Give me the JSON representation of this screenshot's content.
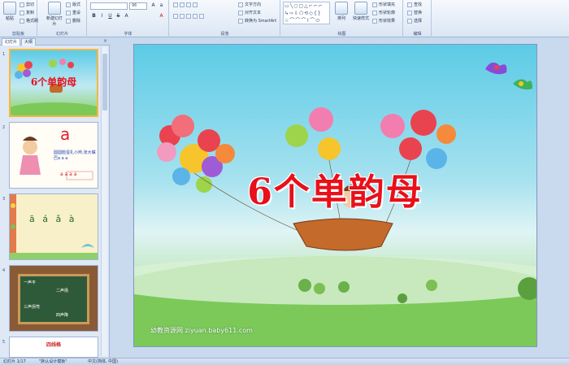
{
  "ribbon": {
    "clipboard": {
      "paste_label": "粘贴",
      "cut_label": "剪切",
      "copy_label": "复制",
      "format_painter_label": "格式刷",
      "group_label": "剪贴板"
    },
    "slides": {
      "new_slide_label": "新建幻灯片",
      "layout_label": "版式",
      "reset_label": "重设",
      "delete_label": "删除",
      "group_label": "幻灯片"
    },
    "font": {
      "font_size": "96",
      "group_label": "字体",
      "bold": "B",
      "italic": "I",
      "underline": "U",
      "strike": "S",
      "shadow": "A",
      "font_color": "A"
    },
    "paragraph": {
      "text_direction_label": "文字方向",
      "align_text_label": "对齐文本",
      "smartart_label": "转换为 SmartArt",
      "group_label": "段落"
    },
    "drawing": {
      "arrange_label": "排列",
      "quick_styles_label": "快速样式",
      "shape_fill_label": "形状填充",
      "shape_outline_label": "形状轮廓",
      "shape_effects_label": "形状效果",
      "group_label": "绘图"
    },
    "editing": {
      "find_label": "查找",
      "replace_label": "替换",
      "select_label": "选择",
      "group_label": "编辑"
    }
  },
  "left_pane": {
    "tab_slides": "幻灯片",
    "tab_outline": "大纲",
    "close_glyph": "×",
    "thumbnails": [
      {
        "num": "1",
        "title": "6个单韵母"
      },
      {
        "num": "2",
        "letter": "a",
        "caption": "圆圆脸蛋扎小辫,张大嘴巴a a a",
        "pinyin": "a a a a"
      },
      {
        "num": "3",
        "pinyin": "ā á ǎ à"
      },
      {
        "num": "4",
        "lines": [
          "一声平",
          "二声扬",
          "三声拐弯",
          "四声降"
        ]
      },
      {
        "num": "5",
        "title": "四线格"
      }
    ]
  },
  "slide": {
    "title": "6个单韵母",
    "watermark": "幼教资源网 ziyuan.baby611.com"
  },
  "status_bar": {
    "slide_indicator": "幻灯片 1/17",
    "theme": "\"默认设计模板\"",
    "language": "中文(简体, 中国)"
  },
  "colors": {
    "title_red": "#e8101a",
    "ribbon_bg": "#dbe6f4",
    "selection": "#f6b73c"
  }
}
